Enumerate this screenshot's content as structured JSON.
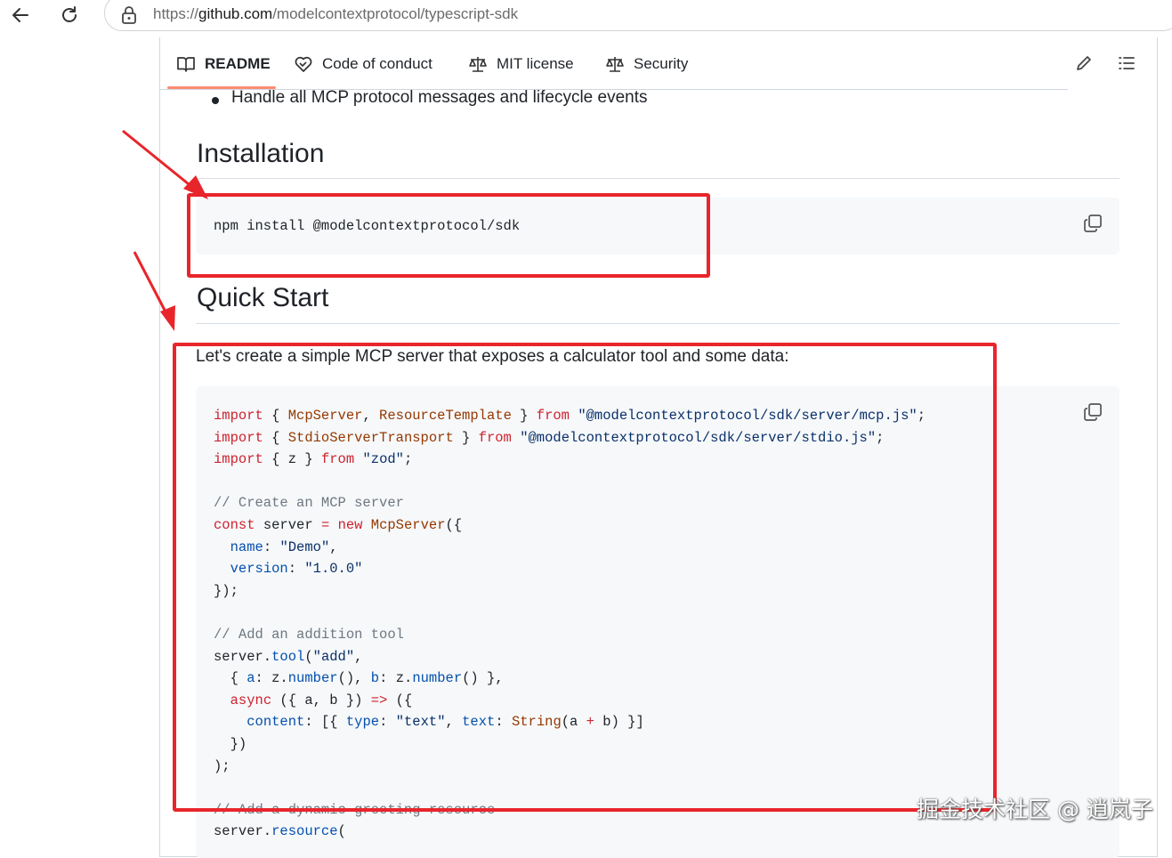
{
  "browser": {
    "url_prefix": "https://",
    "url_host": "github.com",
    "url_path": "/modelcontextprotocol/typescript-sdk",
    "back_icon": "arrow-left-icon",
    "reload_icon": "reload-icon",
    "lock_icon": "lock-icon"
  },
  "tabs": [
    {
      "label": "README",
      "icon": "book-icon",
      "active": true
    },
    {
      "label": "Code of conduct",
      "icon": "heart-handshake-icon",
      "active": false
    },
    {
      "label": "MIT license",
      "icon": "law-icon",
      "active": false
    },
    {
      "label": "Security",
      "icon": "law-icon",
      "active": false
    }
  ],
  "toolbar": {
    "edit_icon": "pencil-icon",
    "outline_icon": "list-icon"
  },
  "content": {
    "bullet": "Handle all MCP protocol messages and lifecycle events",
    "installation_heading": "Installation",
    "install_command": "npm install @modelcontextprotocol/sdk",
    "quickstart_heading": "Quick Start",
    "quickstart_intro": "Let's create a simple MCP server that exposes a calculator tool and some data:",
    "code_lines": [
      [
        [
          "k",
          "import"
        ],
        [
          "p",
          " { "
        ],
        [
          "t",
          "McpServer"
        ],
        [
          "p",
          ", "
        ],
        [
          "t",
          "ResourceTemplate"
        ],
        [
          "p",
          " } "
        ],
        [
          "k",
          "from"
        ],
        [
          "p",
          " "
        ],
        [
          "s",
          "\"@modelcontextprotocol/sdk/server/mcp.js\""
        ],
        [
          "p",
          ";"
        ]
      ],
      [
        [
          "k",
          "import"
        ],
        [
          "p",
          " { "
        ],
        [
          "t",
          "StdioServerTransport"
        ],
        [
          "p",
          " } "
        ],
        [
          "k",
          "from"
        ],
        [
          "p",
          " "
        ],
        [
          "s",
          "\"@modelcontextprotocol/sdk/server/stdio.js\""
        ],
        [
          "p",
          ";"
        ]
      ],
      [
        [
          "k",
          "import"
        ],
        [
          "p",
          " { z } "
        ],
        [
          "k",
          "from"
        ],
        [
          "p",
          " "
        ],
        [
          "s",
          "\"zod\""
        ],
        [
          "p",
          ";"
        ]
      ],
      [],
      [
        [
          "c",
          "// Create an MCP server"
        ]
      ],
      [
        [
          "k",
          "const"
        ],
        [
          "p",
          " server "
        ],
        [
          "k",
          "="
        ],
        [
          "p",
          " "
        ],
        [
          "k",
          "new"
        ],
        [
          "p",
          " "
        ],
        [
          "t",
          "McpServer"
        ],
        [
          "p",
          "({"
        ]
      ],
      [
        [
          "p",
          "  "
        ],
        [
          "n",
          "name"
        ],
        [
          "p",
          ": "
        ],
        [
          "s",
          "\"Demo\""
        ],
        [
          "p",
          ","
        ]
      ],
      [
        [
          "p",
          "  "
        ],
        [
          "n",
          "version"
        ],
        [
          "p",
          ": "
        ],
        [
          "s",
          "\"1.0.0\""
        ]
      ],
      [
        [
          "p",
          "});"
        ]
      ],
      [],
      [
        [
          "c",
          "// Add an addition tool"
        ]
      ],
      [
        [
          "p",
          "server."
        ],
        [
          "n",
          "tool"
        ],
        [
          "p",
          "("
        ],
        [
          "s",
          "\"add\""
        ],
        [
          "p",
          ","
        ]
      ],
      [
        [
          "p",
          "  { "
        ],
        [
          "n",
          "a"
        ],
        [
          "p",
          ": z."
        ],
        [
          "n",
          "number"
        ],
        [
          "p",
          "(), "
        ],
        [
          "n",
          "b"
        ],
        [
          "p",
          ": z."
        ],
        [
          "n",
          "number"
        ],
        [
          "p",
          "() },"
        ]
      ],
      [
        [
          "p",
          "  "
        ],
        [
          "k",
          "async"
        ],
        [
          "p",
          " ({ a, b }) "
        ],
        [
          "k",
          "=>"
        ],
        [
          "p",
          " ({"
        ]
      ],
      [
        [
          "p",
          "    "
        ],
        [
          "n",
          "content"
        ],
        [
          "p",
          ": [{ "
        ],
        [
          "n",
          "type"
        ],
        [
          "p",
          ": "
        ],
        [
          "s",
          "\"text\""
        ],
        [
          "p",
          ", "
        ],
        [
          "n",
          "text"
        ],
        [
          "p",
          ": "
        ],
        [
          "t",
          "String"
        ],
        [
          "p",
          "(a "
        ],
        [
          "k",
          "+"
        ],
        [
          "p",
          " b) }]"
        ]
      ],
      [
        [
          "p",
          "  })"
        ]
      ],
      [
        [
          "p",
          ");"
        ]
      ],
      [],
      [
        [
          "c",
          "// Add a dynamic greeting resource"
        ]
      ],
      [
        [
          "p",
          "server."
        ],
        [
          "n",
          "resource"
        ],
        [
          "p",
          "("
        ]
      ]
    ],
    "copy_icon": "copy-icon"
  },
  "annotations": {
    "color": "#e8252b"
  },
  "watermark": "掘金技术社区 @ 逍岚子"
}
